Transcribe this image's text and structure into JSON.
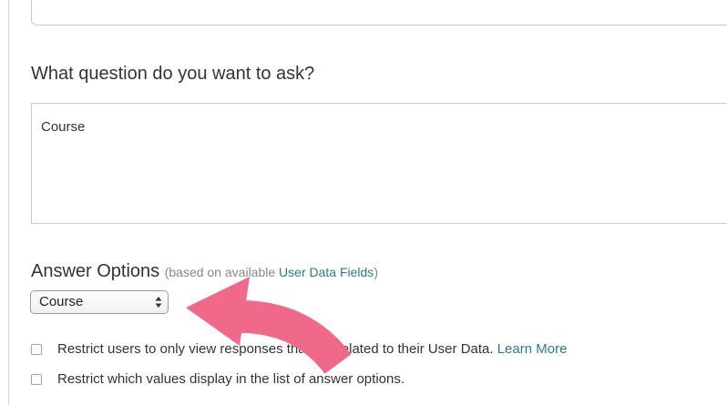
{
  "question": {
    "label": "What question do you want to ask?",
    "textarea_value": "Course"
  },
  "answer_options": {
    "title": "Answer Options",
    "note_prefix": "(based on available ",
    "link_text": "User Data Fields",
    "note_suffix": ")",
    "select_value": "Course"
  },
  "checkboxes": [
    {
      "label": "Restrict users to only view responses that are related to their User Data.",
      "link_text": "Learn More",
      "checked": false
    },
    {
      "label": "Restrict which values display in the list of answer options.",
      "link_text": "",
      "checked": false
    }
  ],
  "colors": {
    "link": "#2a7d8a",
    "callout_arrow": "#f0688a"
  },
  "icons": {
    "select_arrows": "up-down-chevron-icon",
    "callout": "curved-arrow-icon"
  }
}
